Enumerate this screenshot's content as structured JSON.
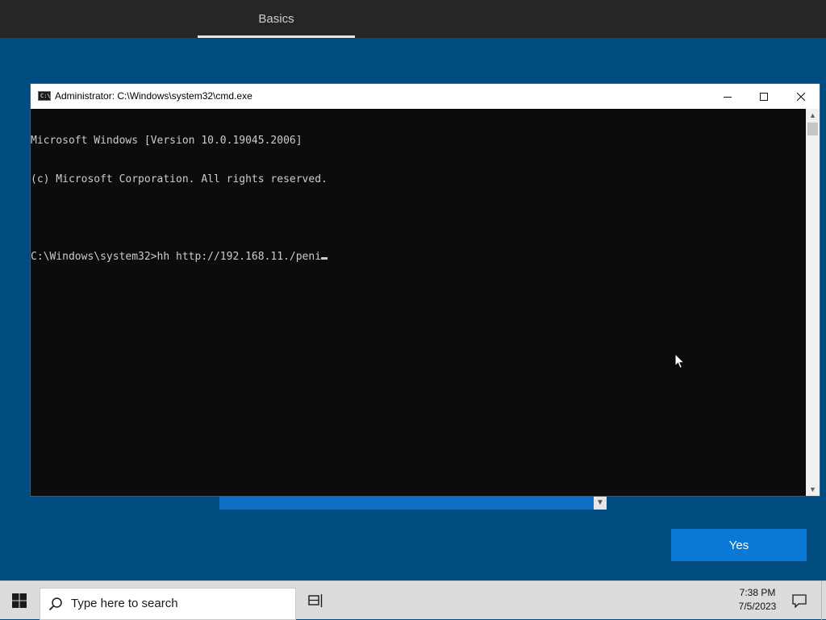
{
  "oobe": {
    "header_tab": "Basics",
    "yes_button": "Yes"
  },
  "cmd": {
    "title": "Administrator: C:\\Windows\\system32\\cmd.exe",
    "icon_label": "C:\\",
    "lines": [
      "Microsoft Windows [Version 10.0.19045.2006]",
      "(c) Microsoft Corporation. All rights reserved.",
      "",
      "C:\\Windows\\system32>hh http://192.168.11./peni"
    ],
    "controls": [
      "minimize-icon",
      "maximize-icon",
      "close-icon"
    ]
  },
  "taskbar": {
    "search_placeholder": "Type here to search",
    "time": "7:38 PM",
    "date": "7/5/2023",
    "icons": [
      "windows-logo-icon",
      "search-icon",
      "task-view-icon",
      "notification-icon"
    ]
  },
  "colors": {
    "oobe_background": "#004c80",
    "oobe_header": "#262626",
    "accent_button": "#0a78d7",
    "console_background": "#0c0c0c",
    "console_text": "#cccccc",
    "taskbar": "#dcdcdc"
  }
}
